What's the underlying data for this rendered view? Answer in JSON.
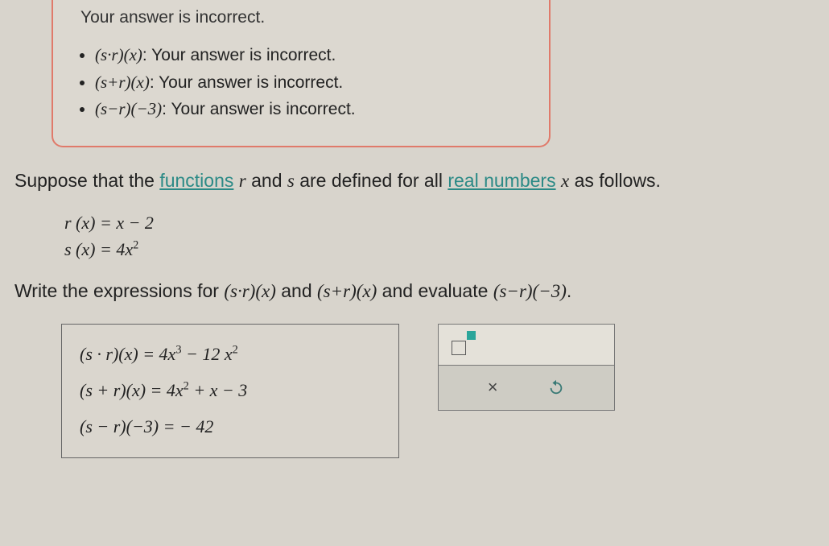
{
  "feedback": {
    "title": "Your answer is incorrect.",
    "items": [
      {
        "expr": "(s·r)(x)",
        "msg": ": Your answer is incorrect."
      },
      {
        "expr": "(s+r)(x)",
        "msg": ": Your answer is incorrect."
      },
      {
        "expr": "(s−r)(−3)",
        "msg": ": Your answer is incorrect."
      }
    ]
  },
  "problem": {
    "pre1": "Suppose that the ",
    "link1": "functions",
    "mid1a": " ",
    "var_r": "r",
    "mid1b": " and ",
    "var_s": "s",
    "mid1c": " are defined for all ",
    "link2": "real numbers",
    "post1a": " ",
    "var_x": "x",
    "post1b": " as follows."
  },
  "defs": {
    "r": "r (x) = x − 2",
    "s_pre": "s (x) = 4x",
    "s_exp": "2"
  },
  "instruction": {
    "pre": "Write the expressions for ",
    "e1": "(s·r)(x)",
    "mid1": " and ",
    "e2": "(s+r)(x)",
    "mid2": " and evaluate ",
    "e3": "(s−r)(−3)",
    "post": "."
  },
  "answers": {
    "r1_lhs": "(s · r)(x) = ",
    "r1_a": "4x",
    "r1_e1": "3",
    "r1_b": " − 12 x",
    "r1_e2": "2",
    "r2_lhs": "(s + r)(x) = ",
    "r2_a": "4x",
    "r2_e1": "2",
    "r2_b": " + x − 3",
    "r3_lhs": "(s − r)(−3) = ",
    "r3_val": "− 42"
  },
  "tools": {
    "clear": "×",
    "undo": "↺"
  }
}
